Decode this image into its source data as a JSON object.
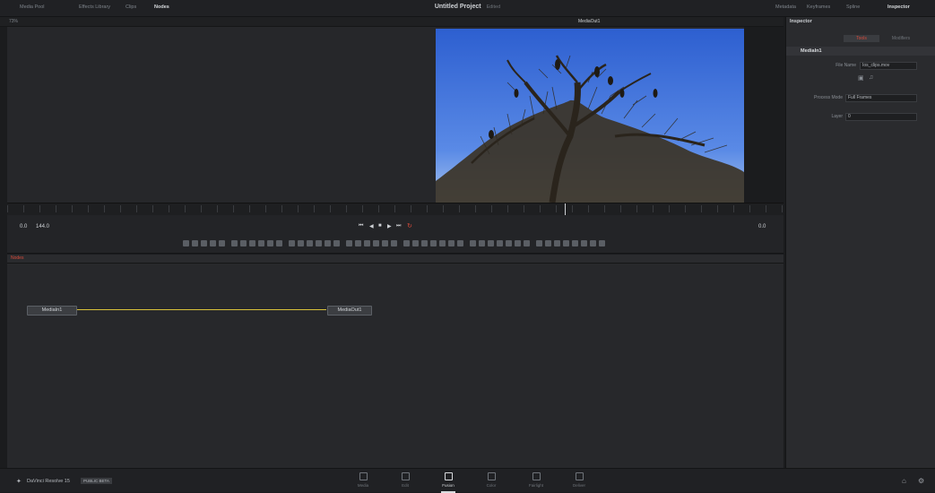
{
  "top_bar": {
    "left_items": [
      "Media Pool",
      "Effects Library",
      "Clips",
      "Nodes"
    ],
    "project_title": "Untitled Project",
    "project_subtitle": "Edited",
    "right_items": [
      "Metadata",
      "Keyframes",
      "Spline",
      "Inspector"
    ]
  },
  "viewer": {
    "zoom_label": "73%",
    "clip_name": "MediaOut1"
  },
  "transport": {
    "start_value": "0.0",
    "end_value": "144.0",
    "current_frame": "0.0"
  },
  "nodes": {
    "tab_label": "Nodes",
    "media_in": "MediaIn1",
    "media_out": "MediaOut1"
  },
  "inspector": {
    "header": "Inspector",
    "tabs": [
      "Tools",
      "Modifiers"
    ],
    "node_name": "MediaIn1",
    "clip_label": "File Name",
    "clip_value": "Ios_clips.mov",
    "process_mode_label": "Process Mode",
    "process_mode_value": "Full Frames",
    "layer_label": "Layer",
    "layer_value": "0"
  },
  "bottom_bar": {
    "app_name": "DaVinci Resolve 15",
    "badge": "PUBLIC BETA",
    "pages": [
      "Media",
      "Edit",
      "Fusion",
      "Color",
      "Fairlight",
      "Deliver"
    ],
    "active_page": "Fusion"
  },
  "colors": {
    "accent_yellow": "#d8c23a",
    "sky_blue": "#3b6fd8",
    "loop_red": "#d94b3b"
  }
}
